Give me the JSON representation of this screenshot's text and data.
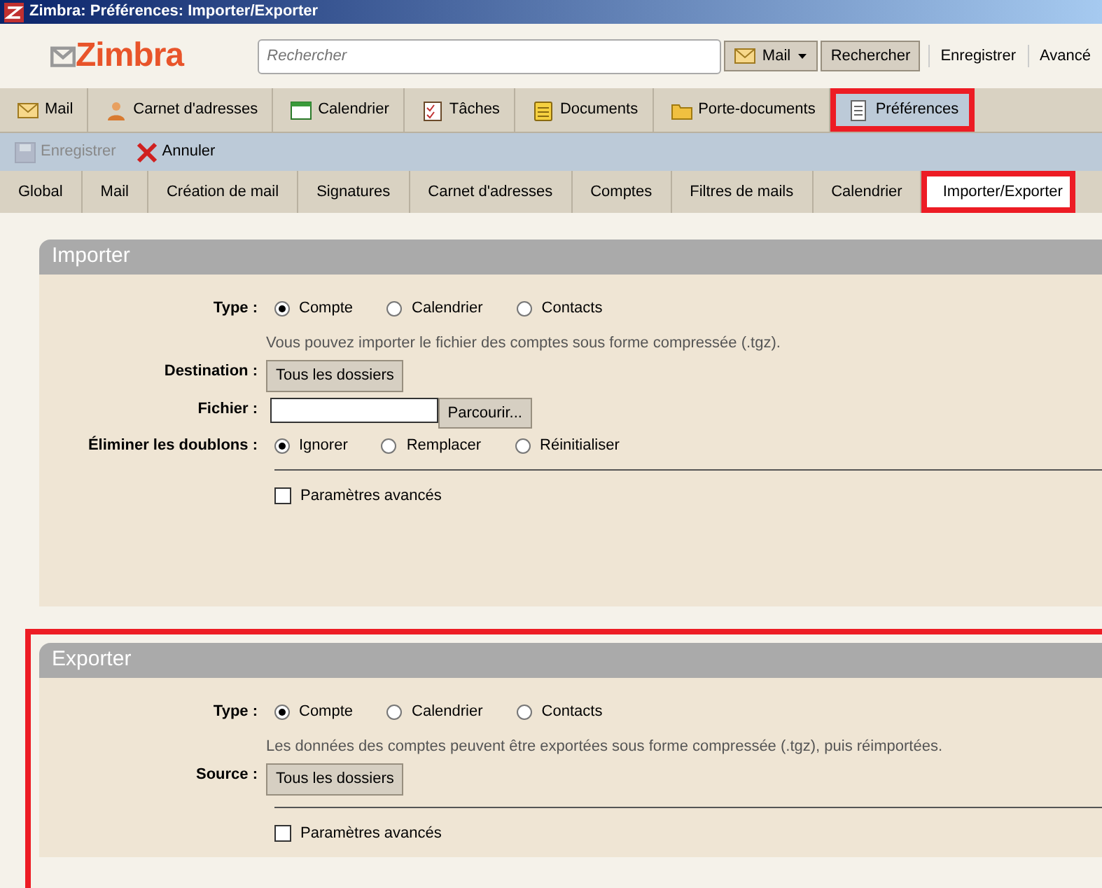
{
  "window": {
    "title": "Zimbra: Préférences: Importer/Exporter"
  },
  "header": {
    "logo": "Zimbra",
    "search": {
      "placeholder": "Rechercher"
    },
    "search_type": "Mail",
    "search_button": "Rechercher",
    "links": [
      "Enregistrer",
      "Avancé"
    ]
  },
  "app_tabs": [
    {
      "label": "Mail",
      "kind": "envelope",
      "selected": false,
      "highlighted": false
    },
    {
      "label": "Carnet d'adresses",
      "kind": "person",
      "selected": false,
      "highlighted": false
    },
    {
      "label": "Calendrier",
      "kind": "calendar",
      "selected": false,
      "highlighted": false
    },
    {
      "label": "Tâches",
      "kind": "tasks",
      "selected": false,
      "highlighted": false
    },
    {
      "label": "Documents",
      "kind": "notepad",
      "selected": false,
      "highlighted": false
    },
    {
      "label": "Porte-documents",
      "kind": "folder",
      "selected": false,
      "highlighted": false
    },
    {
      "label": "Préférences",
      "kind": "list",
      "selected": true,
      "highlighted": true
    }
  ],
  "toolbar": [
    {
      "label": "Enregistrer",
      "kind": "save",
      "disabled": true
    },
    {
      "label": "Annuler",
      "kind": "cancel",
      "disabled": false
    }
  ],
  "pref_tabs": [
    {
      "label": "Global",
      "selected": false,
      "highlighted": false
    },
    {
      "label": "Mail",
      "selected": false,
      "highlighted": false
    },
    {
      "label": "Création de mail",
      "selected": false,
      "highlighted": false
    },
    {
      "label": "Signatures",
      "selected": false,
      "highlighted": false
    },
    {
      "label": "Carnet d'adresses",
      "selected": false,
      "highlighted": false
    },
    {
      "label": "Comptes",
      "selected": false,
      "highlighted": false
    },
    {
      "label": "Filtres de mails",
      "selected": false,
      "highlighted": false
    },
    {
      "label": "Calendrier",
      "selected": false,
      "highlighted": false
    },
    {
      "label": "Importer/Exporter",
      "selected": true,
      "highlighted": true
    }
  ],
  "sections": [
    {
      "title": "Importer",
      "highlighted": false,
      "rows": [
        {
          "kind": "radio",
          "label": "Type :",
          "options": [
            {
              "label": "Compte",
              "selected": true
            },
            {
              "label": "Calendrier",
              "selected": false
            },
            {
              "label": "Contacts",
              "selected": false
            }
          ]
        },
        {
          "kind": "hint",
          "text": "Vous pouvez importer le fichier des comptes sous forme compressée (.tgz)."
        },
        {
          "kind": "button",
          "label": "Destination :",
          "button": "Tous les dossiers"
        },
        {
          "kind": "file",
          "label": "Fichier :",
          "button": "Parcourir..."
        },
        {
          "kind": "radio",
          "label": "Éliminer les doublons :",
          "options": [
            {
              "label": "Ignorer",
              "selected": true
            },
            {
              "label": "Remplacer",
              "selected": false
            },
            {
              "label": "Réinitialiser",
              "selected": false
            }
          ]
        },
        {
          "kind": "divider"
        },
        {
          "kind": "checkbox",
          "label": "Paramètres avancés",
          "checked": false
        }
      ]
    },
    {
      "title": "Exporter",
      "highlighted": true,
      "rows": [
        {
          "kind": "radio",
          "label": "Type :",
          "options": [
            {
              "label": "Compte",
              "selected": true
            },
            {
              "label": "Calendrier",
              "selected": false
            },
            {
              "label": "Contacts",
              "selected": false
            }
          ]
        },
        {
          "kind": "hint",
          "text": "Les données des comptes peuvent être exportées sous forme compressée (.tgz), puis réimportées."
        },
        {
          "kind": "button",
          "label": "Source :",
          "button": "Tous les dossiers"
        },
        {
          "kind": "divider"
        },
        {
          "kind": "checkbox",
          "label": "Paramètres avancés",
          "checked": false
        }
      ]
    }
  ]
}
